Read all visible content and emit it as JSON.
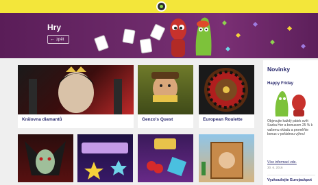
{
  "header": {
    "logo_icon": "smiley-logo-icon",
    "bg_color": "#f3e63a"
  },
  "hero": {
    "title": "Hry",
    "back_label": "zpět",
    "back_icon": "arrow-left-icon",
    "bg_color": "#6d2a6a"
  },
  "games": [
    {
      "name": "Královna diamantů",
      "thumb": "diamond-queen-thumb"
    },
    {
      "name": "Genzo's Quest",
      "thumb": "gonzos-quest-thumb"
    },
    {
      "name": "European Roulette",
      "thumb": "roulette-wheel-thumb"
    },
    {
      "name": "",
      "thumb": "vampire-thumb"
    },
    {
      "name": "",
      "thumb": "starburst-thumb"
    },
    {
      "name": "",
      "thumb": "bar-slot-thumb"
    },
    {
      "name": "",
      "thumb": "wanted-poster-thumb"
    }
  ],
  "sidebar": {
    "title": "Novinky",
    "news_title": "Happy Friday",
    "news_text": "Objevujte každý pátek svět Sazka Her a bonusem 25 % k vašemu vkladu a proměňte bonus v pořádnou výhru!",
    "link": "Více informací zde.",
    "date": "30. 6. 2016",
    "next_title": "Vyzkoušejte Eurojackpot"
  }
}
